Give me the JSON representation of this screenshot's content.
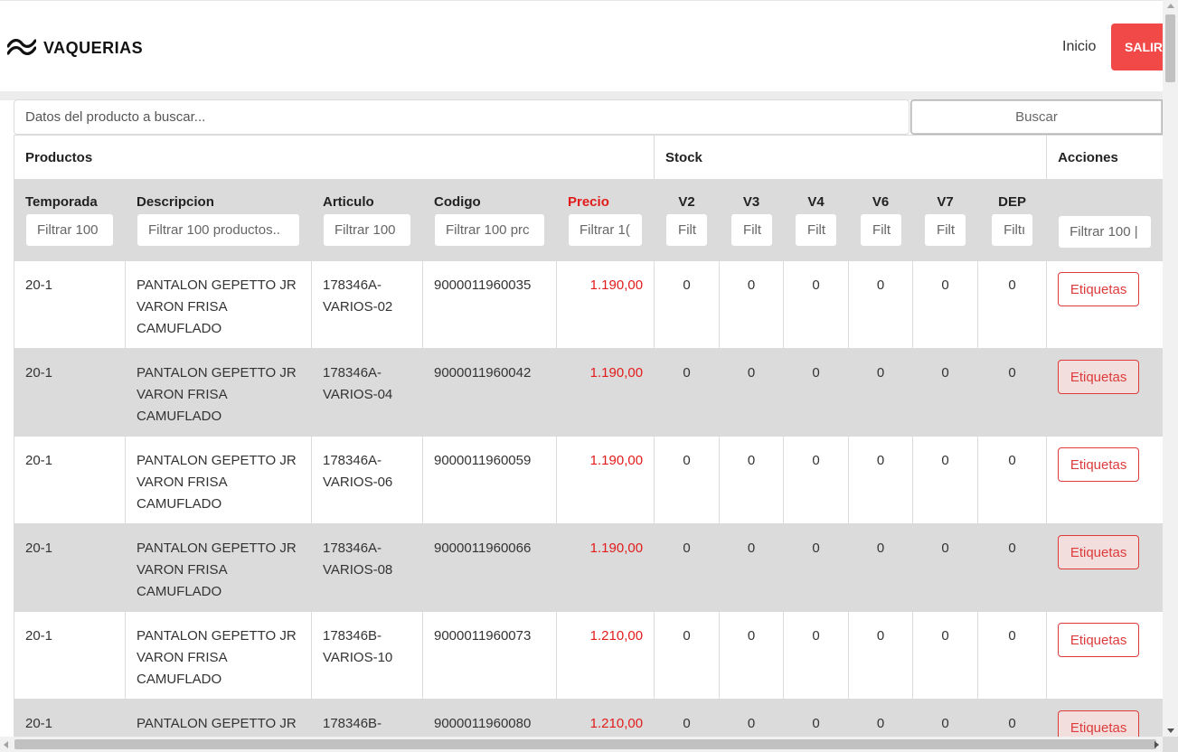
{
  "navbar": {
    "brand": "VAQUERIAS",
    "brand_icon": "wave-logo-icon",
    "inicio_label": "Inicio",
    "salir_label": "SALIR",
    "salir_color": "#f14848"
  },
  "search": {
    "placeholder": "Datos del producto a buscar...",
    "button_label": "Buscar"
  },
  "table": {
    "groups": {
      "productos": "Productos",
      "stock": "Stock",
      "acciones": "Acciones"
    },
    "columns": {
      "temporada": "Temporada",
      "descripcion": "Descripcion",
      "articulo": "Articulo",
      "codigo": "Codigo",
      "precio": "Precio",
      "v2": "V2",
      "v3": "V3",
      "v4": "V4",
      "v6": "V6",
      "v7": "V7",
      "dep": "DEP"
    },
    "filters": {
      "temporada": "Filtrar 100",
      "descripcion": "Filtrar 100 productos..",
      "articulo": "Filtrar 100",
      "codigo": "Filtrar 100 prc",
      "precio": "Filtrar 1(",
      "v2": "Filt",
      "v3": "Filt",
      "v4": "Filt",
      "v6": "Filt",
      "v7": "Filt",
      "dep": "Filtı",
      "acciones": "Filtrar 100 |"
    },
    "price_color": "#e21b1b",
    "rows": [
      {
        "temporada": "20-1",
        "descripcion": "PANTALON GEPETTO JR VARON FRISA CAMUFLADO",
        "articulo": "178346A-VARIOS-02",
        "codigo": "9000011960035",
        "precio": "1.190,00",
        "v2": "0",
        "v3": "0",
        "v4": "0",
        "v6": "0",
        "v7": "0",
        "dep": "0",
        "accion": "Etiquetas"
      },
      {
        "temporada": "20-1",
        "descripcion": "PANTALON GEPETTO JR VARON FRISA CAMUFLADO",
        "articulo": "178346A-VARIOS-04",
        "codigo": "9000011960042",
        "precio": "1.190,00",
        "v2": "0",
        "v3": "0",
        "v4": "0",
        "v6": "0",
        "v7": "0",
        "dep": "0",
        "accion": "Etiquetas"
      },
      {
        "temporada": "20-1",
        "descripcion": "PANTALON GEPETTO JR VARON FRISA CAMUFLADO",
        "articulo": "178346A-VARIOS-06",
        "codigo": "9000011960059",
        "precio": "1.190,00",
        "v2": "0",
        "v3": "0",
        "v4": "0",
        "v6": "0",
        "v7": "0",
        "dep": "0",
        "accion": "Etiquetas"
      },
      {
        "temporada": "20-1",
        "descripcion": "PANTALON GEPETTO JR VARON FRISA CAMUFLADO",
        "articulo": "178346A-VARIOS-08",
        "codigo": "9000011960066",
        "precio": "1.190,00",
        "v2": "0",
        "v3": "0",
        "v4": "0",
        "v6": "0",
        "v7": "0",
        "dep": "0",
        "accion": "Etiquetas"
      },
      {
        "temporada": "20-1",
        "descripcion": "PANTALON GEPETTO JR VARON FRISA CAMUFLADO",
        "articulo": "178346B-VARIOS-10",
        "codigo": "9000011960073",
        "precio": "1.210,00",
        "v2": "0",
        "v3": "0",
        "v4": "0",
        "v6": "0",
        "v7": "0",
        "dep": "0",
        "accion": "Etiquetas"
      },
      {
        "temporada": "20-1",
        "descripcion": "PANTALON GEPETTO JR",
        "articulo": "178346B-",
        "codigo": "9000011960080",
        "precio": "1.210,00",
        "v2": "0",
        "v3": "0",
        "v4": "0",
        "v6": "0",
        "v7": "0",
        "dep": "0",
        "accion": "Etiquetas"
      }
    ]
  }
}
